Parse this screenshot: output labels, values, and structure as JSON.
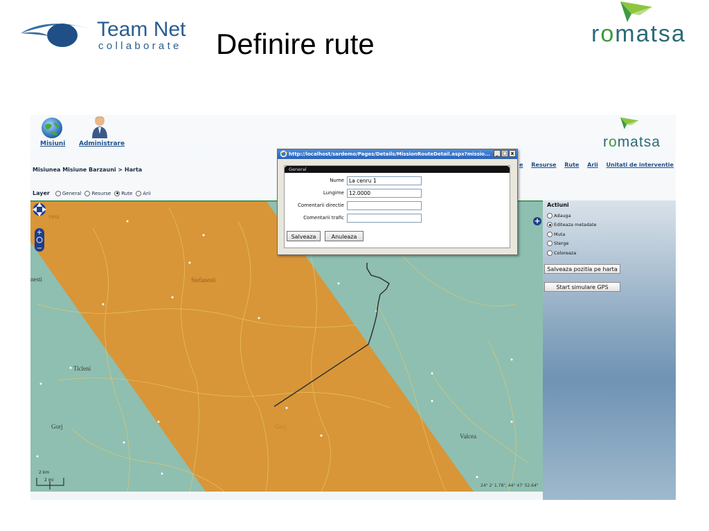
{
  "slide": {
    "title": "Definire rute",
    "teamnet_name": "Team Net",
    "teamnet_tagline": "collaborate",
    "romatsa_word": "romatsa"
  },
  "app": {
    "nav": {
      "missions_label": "Misiuni",
      "admin_label": "Administrare"
    },
    "logo_word": "romatsa",
    "menu": [
      "Resurse",
      "Rute",
      "Arii",
      "Unitati de interventie"
    ],
    "menu_cut_prefix": "e",
    "breadcrumb": "Misiunea Misiune Barzauni > Harta",
    "layer": {
      "label": "Layer",
      "options": [
        "General",
        "Resurse",
        "Rute",
        "Arii"
      ],
      "selected": "Rute"
    },
    "map": {
      "labels": {
        "veni": "veni",
        "nesti": "nesti",
        "stefanesti": "Stefanesti",
        "ticleni": "Ticleni",
        "gorj_left": "Gorj",
        "gorj_center": "Gorj",
        "valcea": "Valcea"
      },
      "coordinates": "24° 2' 1.78\", 44° 47' 52.64\"",
      "scale_km": "2 km",
      "scale_mi": "2 mi"
    },
    "actions": {
      "title": "Actiuni",
      "options": [
        "Adauga",
        "Editeaza metadate",
        "Muta",
        "Sterge",
        "Coloreaza"
      ],
      "selected": "Editeaza metadate",
      "save_map_position": "Salveaza pozitia pe harta",
      "start_gps": "Start simulare GPS"
    },
    "popup": {
      "url": "http://localhost/sardemo/Pages/Details/MissionRouteDetail.aspx?missio...",
      "panel_title": "General",
      "fields": [
        {
          "label": "Nume",
          "value": "La cenru 1"
        },
        {
          "label": "Lungime",
          "value": "12.0000"
        },
        {
          "label": "Comentarii directie",
          "value": ""
        },
        {
          "label": "Comentarii trafic",
          "value": ""
        }
      ],
      "save_label": "Salveaza",
      "cancel_label": "Anuleaza"
    }
  },
  "colors": {
    "map_green": "#8fbfb0",
    "map_orange": "#d89638",
    "brand_blue": "#2a5d92",
    "romatsa_teal": "#2b6a77"
  }
}
